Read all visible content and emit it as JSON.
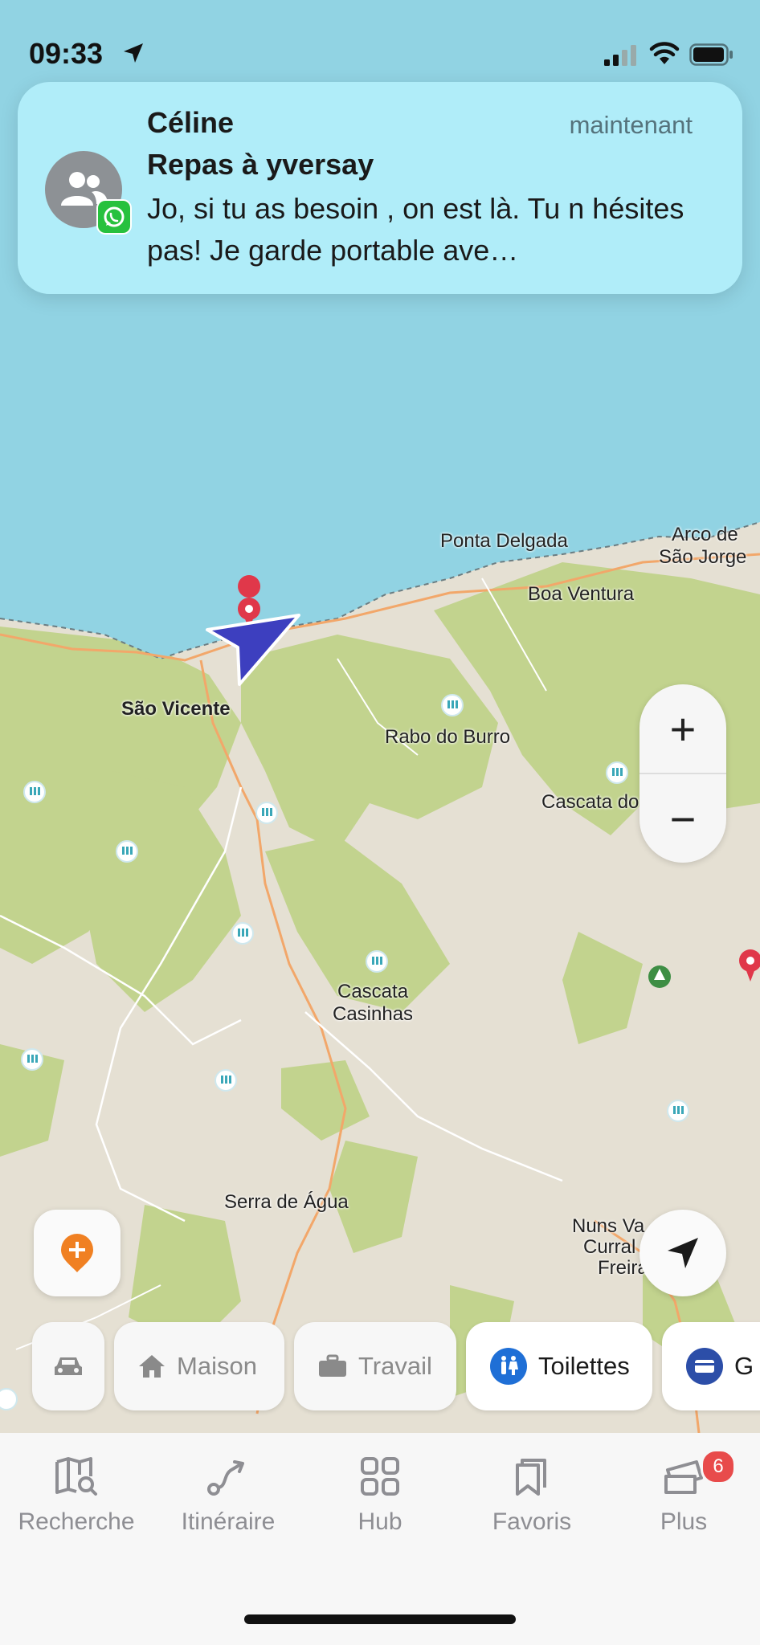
{
  "status": {
    "time": "09:33"
  },
  "notification": {
    "sender": "Céline",
    "time": "maintenant",
    "title": "Repas à yversay",
    "body": "Jo, si tu as besoin , on est là. Tu n hésites pas! Je garde portable ave…",
    "app_icon": "whatsapp-icon",
    "avatar_icon": "group-icon"
  },
  "map": {
    "labels": {
      "ponta_delgada": "Ponta Delgada",
      "arco_line1": "Arco de",
      "arco_line2": "São Jorge",
      "boa_ventura": "Boa Ventura",
      "sao_vicente": "São Vicente",
      "rabo_do_burro": "Rabo do Burro",
      "cascata_do": "Cascata do",
      "cascata_casinhas_1": "Cascata",
      "cascata_casinhas_2": "Casinhas",
      "serra_de_agua": "Serra de Água",
      "nuns_1": "Nuns Va",
      "nuns_2": "Curral",
      "nuns_3": "Freira"
    },
    "colors": {
      "sea": "#91d3e3",
      "land": "#e5e0d3",
      "forest": "#c2d38e",
      "road": "#f2a76a"
    }
  },
  "controls": {
    "zoom_in": "+",
    "zoom_out": "−"
  },
  "chips": [
    {
      "label": "",
      "icon": "car-icon"
    },
    {
      "label": "Maison",
      "icon": "home-icon"
    },
    {
      "label": "Travail",
      "icon": "briefcase-icon"
    },
    {
      "label": "Toilettes",
      "icon": "toilet-icon"
    },
    {
      "label": "G",
      "icon": "card-icon"
    }
  ],
  "tabs": [
    {
      "label": "Recherche",
      "icon": "map-search-icon"
    },
    {
      "label": "Itinéraire",
      "icon": "route-icon"
    },
    {
      "label": "Hub",
      "icon": "grid-icon"
    },
    {
      "label": "Favoris",
      "icon": "bookmark-icon"
    },
    {
      "label": "Plus",
      "icon": "tickets-icon",
      "badge": "6"
    }
  ]
}
